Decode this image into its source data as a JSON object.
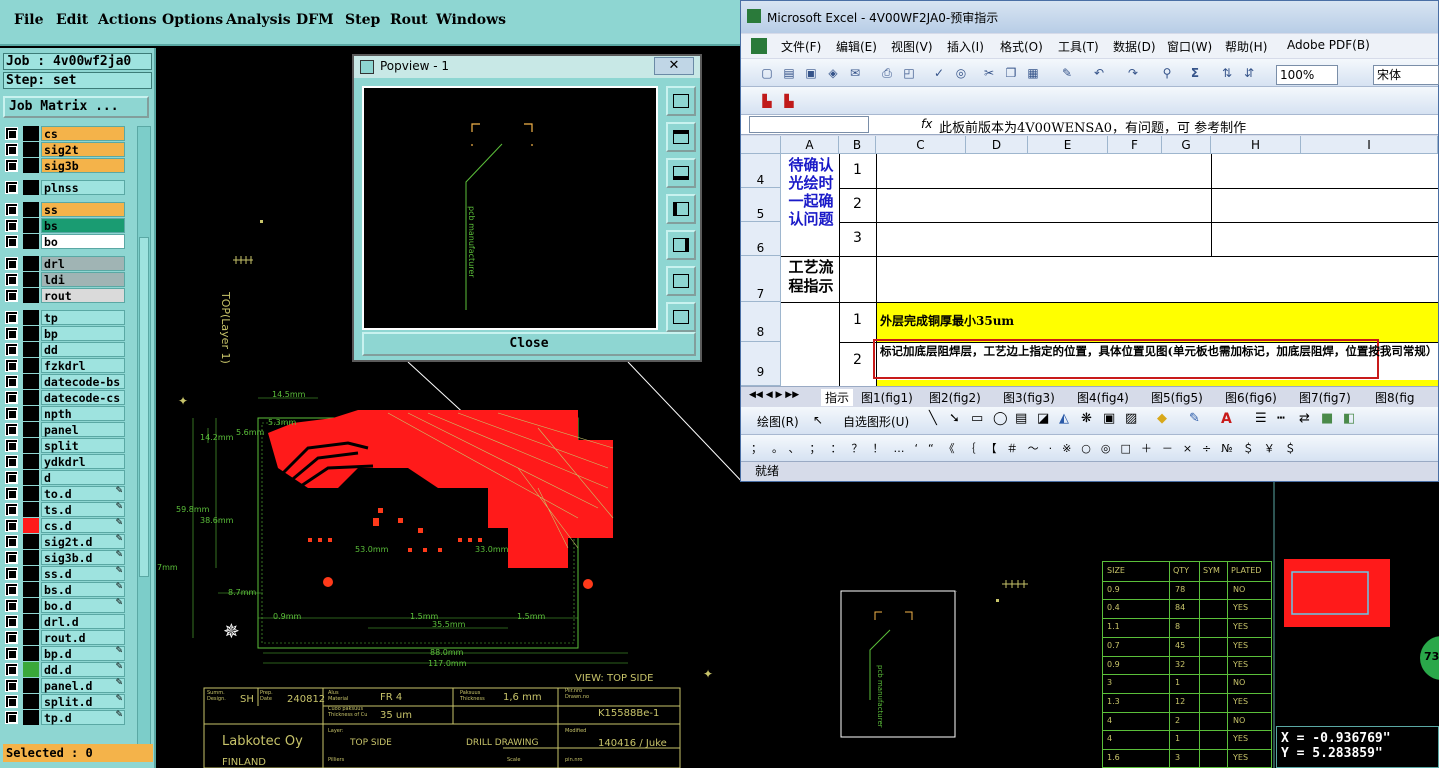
{
  "menubar": {
    "items": [
      "File",
      "Edit",
      "Actions",
      "Options",
      "Analysis",
      "DFM",
      "Step",
      "Rout",
      "Windows"
    ]
  },
  "leftpanel": {
    "job": "Job : 4v00wf2ja0",
    "step": "Step: set",
    "job_matrix": "Job Matrix ...",
    "selected": "Selected : 0",
    "layers": [
      {
        "name": "cs",
        "color": "#f4b34a",
        "swatch": "#000000",
        "lock": ""
      },
      {
        "name": "sig2t",
        "color": "#f4b34a",
        "swatch": "#000000",
        "lock": ""
      },
      {
        "name": "sig3b",
        "color": "#f4b34a",
        "swatch": "#000000",
        "lock": ""
      },
      {
        "name": "plnss",
        "color": "#9ee3df",
        "swatch": "#000000",
        "lock": ""
      },
      {
        "name": "ss",
        "color": "#f4b34a",
        "swatch": "#000000",
        "lock": ""
      },
      {
        "name": "bs",
        "color": "#1a9c72",
        "swatch": "#000000",
        "lock": ""
      },
      {
        "name": "bo",
        "color": "#ffffff",
        "swatch": "#000000",
        "lock": ""
      },
      {
        "name": "drl",
        "color": "#a0b4b4",
        "swatch": "#000000",
        "lock": ""
      },
      {
        "name": "ldi",
        "color": "#a0b4b4",
        "swatch": "#000000",
        "lock": ""
      },
      {
        "name": "rout",
        "color": "#dadada",
        "swatch": "#000000",
        "lock": ""
      },
      {
        "name": "tp",
        "color": "#9ee3df",
        "swatch": "#000000",
        "lock": ""
      },
      {
        "name": "bp",
        "color": "#9ee3df",
        "swatch": "#000000",
        "lock": ""
      },
      {
        "name": "dd",
        "color": "#9ee3df",
        "swatch": "#000000",
        "lock": ""
      },
      {
        "name": "fzkdrl",
        "color": "#9ee3df",
        "swatch": "#000000",
        "lock": ""
      },
      {
        "name": "datecode-bs",
        "color": "#9ee3df",
        "swatch": "#000000",
        "lock": ""
      },
      {
        "name": "datecode-cs",
        "color": "#9ee3df",
        "swatch": "#000000",
        "lock": ""
      },
      {
        "name": "npth",
        "color": "#9ee3df",
        "swatch": "#000000",
        "lock": ""
      },
      {
        "name": "panel",
        "color": "#9ee3df",
        "swatch": "#000000",
        "lock": ""
      },
      {
        "name": "split",
        "color": "#9ee3df",
        "swatch": "#000000",
        "lock": ""
      },
      {
        "name": "ydkdrl",
        "color": "#9ee3df",
        "swatch": "#000000",
        "lock": ""
      },
      {
        "name": "d",
        "color": "#9ee3df",
        "swatch": "#000000",
        "lock": ""
      },
      {
        "name": "to.d",
        "color": "#9ee3df",
        "swatch": "#000000",
        "lock": "✎"
      },
      {
        "name": "ts.d",
        "color": "#9ee3df",
        "swatch": "#000000",
        "lock": "✎"
      },
      {
        "name": "cs.d",
        "color": "#9ee3df",
        "swatch": "#ff1a1a",
        "lock": "✎"
      },
      {
        "name": "sig2t.d",
        "color": "#9ee3df",
        "swatch": "#000000",
        "lock": "✎"
      },
      {
        "name": "sig3b.d",
        "color": "#9ee3df",
        "swatch": "#000000",
        "lock": "✎"
      },
      {
        "name": "ss.d",
        "color": "#9ee3df",
        "swatch": "#000000",
        "lock": "✎"
      },
      {
        "name": "bs.d",
        "color": "#9ee3df",
        "swatch": "#000000",
        "lock": "✎"
      },
      {
        "name": "bo.d",
        "color": "#9ee3df",
        "swatch": "#000000",
        "lock": "✎"
      },
      {
        "name": "drl.d",
        "color": "#9ee3df",
        "swatch": "#000000",
        "lock": ""
      },
      {
        "name": "rout.d",
        "color": "#9ee3df",
        "swatch": "#000000",
        "lock": ""
      },
      {
        "name": "bp.d",
        "color": "#9ee3df",
        "swatch": "#000000",
        "lock": "✎"
      },
      {
        "name": "dd.d",
        "color": "#9ee3df",
        "swatch": "#3aa83a",
        "lock": "✎"
      },
      {
        "name": "panel.d",
        "color": "#9ee3df",
        "swatch": "#000000",
        "lock": "✎"
      },
      {
        "name": "split.d",
        "color": "#9ee3df",
        "swatch": "#000000",
        "lock": "✎"
      },
      {
        "name": "tp.d",
        "color": "#9ee3df",
        "swatch": "#000000",
        "lock": "✎"
      }
    ]
  },
  "popview": {
    "title": "Popview - 1",
    "close_x": "✕",
    "close_label": "Close",
    "canvas_text": "pcb manufacturer"
  },
  "excel": {
    "title": "Microsoft Excel - 4V00WF2JA0-预审指示",
    "menus": [
      "文件(F)",
      "编辑(E)",
      "视图(V)",
      "插入(I)",
      "格式(O)",
      "工具(T)",
      "数据(D)",
      "窗口(W)",
      "帮助(H)",
      "Adobe PDF(B)"
    ],
    "zoom": "100%",
    "font": "宋体",
    "fx": "fx",
    "formula": "此板前版本为4V00WENSA0，有问题，可 参考制作",
    "columns": [
      "A",
      "B",
      "C",
      "D",
      "E",
      "F",
      "G",
      "H",
      "I"
    ],
    "rows": [
      "4",
      "5",
      "6",
      "7",
      "8",
      "9"
    ],
    "a_block1": "待确认光绘时一起确认问题",
    "a_block2": "工艺流程指示",
    "b_values": [
      "1",
      "2",
      "3",
      "1",
      "2"
    ],
    "row8_text": "外层完成铜厚最小35um",
    "row9_text": "标记加底层阻焊层，工艺边上指定的位置，具体位置见图(单元板也需加标记，加底层阻焊，位置按我司常规）",
    "tabs": [
      "指示",
      "图1(fig1)",
      "图2(fig2)",
      "图3(fig3)",
      "图4(fig4)",
      "图5(fig5)",
      "图6(fig6)",
      "图7(fig7)",
      "图8(fig"
    ],
    "draw_label": "绘图(R)",
    "autoshape_label": "自选图形(U)",
    "symbols": "；  。 、  ；  ：  ？  ！  …  ‘  “  《  ｛  【  ＃  ～  ·  ※  ○  ◎  □  ＋  －  ×  ÷  №  ＄  ￥  ＄",
    "status": "就绪"
  },
  "cad": {
    "layer_label": "TOP(Layer 1)",
    "view_label": "VIEW: TOP SIDE",
    "dims": [
      "14.5mm",
      "5.3mm",
      "5.6mm",
      "14.2mm",
      "59.8mm",
      "38.6mm",
      "7mm",
      "8.7mm",
      "0.9mm",
      "1.5mm",
      "35.5mm",
      "1.5mm",
      "53.0mm",
      "33.0mm",
      "88.0mm",
      "117.0mm"
    ],
    "title_block": {
      "company": "Labkotec Oy",
      "suffix": "FINLAND",
      "sum_label": "Summ.\nDesign.",
      "sum_value": "SH",
      "prep_label": "Prep.\nDate",
      "prep_value": "240812",
      "material_label": "Alus\nMaterial",
      "material_value": "FR 4",
      "thickness_label": "Paksuus\nThickness",
      "thickness_value": "1,6 mm",
      "drawno_label": "Piir.nro\nDrawn.no",
      "drawno_value": "K15588Be-1",
      "cu_label": "Cuoo paksuus\nThickness of Cu",
      "cu_value": "35 um",
      "mod_label": "Modified",
      "mod_value": "140416 / Juke",
      "layer_label": "Layer:",
      "layer_value": "TOP SIDE",
      "drill_value": "DRILL DRAWING",
      "pilots_label": "Pilliers",
      "scale_label": "Scale",
      "sheet_label": "pin.nro"
    },
    "drill_table": {
      "headers": [
        "SIZE",
        "QTY",
        "SYM",
        "PLATED"
      ],
      "rows": [
        [
          "0.9",
          "78",
          "",
          "NO"
        ],
        [
          "0.4",
          "84",
          "",
          "YES"
        ],
        [
          "1.1",
          "8",
          "",
          "YES"
        ],
        [
          "0.7",
          "45",
          "",
          "YES"
        ],
        [
          "0.9",
          "32",
          "",
          "YES"
        ],
        [
          "3",
          "1",
          "",
          "NO"
        ],
        [
          "1.3",
          "12",
          "",
          "YES"
        ],
        [
          "4",
          "2",
          "",
          "NO"
        ],
        [
          "4",
          "1",
          "",
          "YES"
        ],
        [
          "1.6",
          "3",
          "",
          "YES"
        ]
      ]
    },
    "badge": "73",
    "coords_x": "X = -0.936769\"",
    "coords_y": "Y = 5.283859\""
  }
}
